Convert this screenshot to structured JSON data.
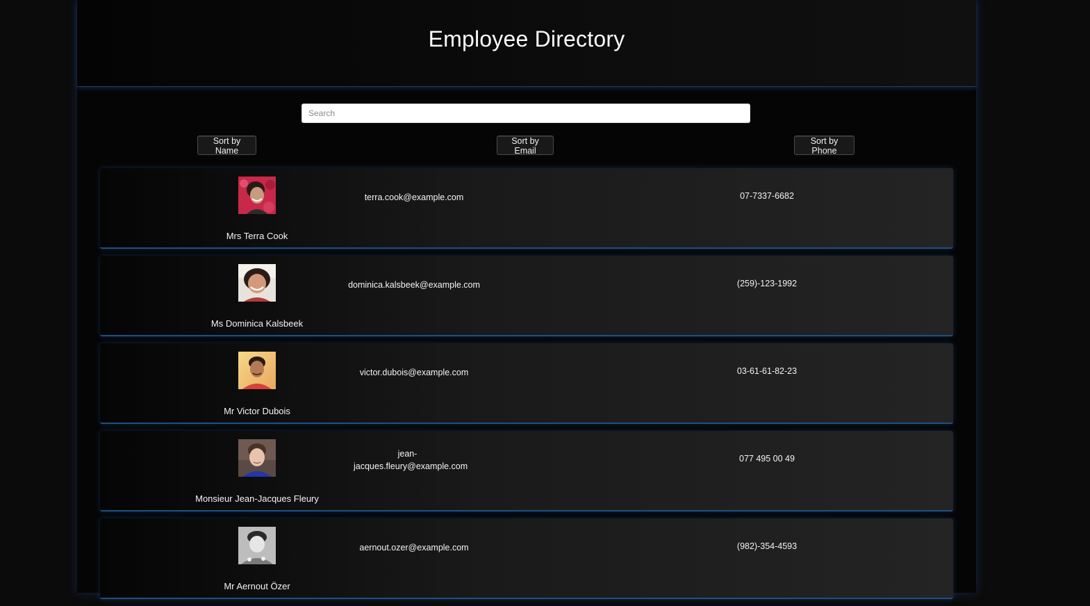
{
  "header": {
    "title": "Employee Directory"
  },
  "search": {
    "placeholder": "Search",
    "value": ""
  },
  "sort_buttons": {
    "name": "Sort by Name",
    "email": "Sort by Email",
    "phone": "Sort by Phone"
  },
  "employees": [
    {
      "name": "Mrs Terra Cook",
      "email": "terra.cook@example.com",
      "phone": "07-7337-6682",
      "avatar": "avatar-photo"
    },
    {
      "name": "Ms Dominica Kalsbeek",
      "email": "dominica.kalsbeek@example.com",
      "phone": "(259)-123-1992",
      "avatar": "avatar-photo"
    },
    {
      "name": "Mr Victor Dubois",
      "email": "victor.dubois@example.com",
      "phone": "03-61-61-82-23",
      "avatar": "avatar-photo"
    },
    {
      "name": "Monsieur Jean-Jacques Fleury",
      "email": "jean-jacques.fleury@example.com",
      "phone": "077 495 00 49",
      "avatar": "avatar-photo"
    },
    {
      "name": "Mr Aernout Özer",
      "email": "aernout.ozer@example.com",
      "phone": "(982)-354-4593",
      "avatar": "avatar-photo"
    }
  ],
  "colors": {
    "background": "#0b0b0b",
    "panel": "#050505",
    "accent_glow": "#1f4f82",
    "text": "#f4f4f4"
  }
}
